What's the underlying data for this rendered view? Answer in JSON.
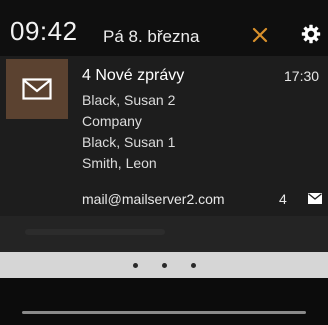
{
  "status": {
    "clock": "09:42",
    "date": "Pá 8. března",
    "dismiss_icon": "close-icon",
    "settings_icon": "gear-icon",
    "accent_color": "#d8902c"
  },
  "notification": {
    "app_icon": "mail-icon",
    "title": "4 Nové zprávy",
    "time": "17:30",
    "lines": [
      "Black, Susan 2",
      "Company",
      "Black, Susan 1",
      "Smith, Leon"
    ],
    "account": "mail@mailserver2.com",
    "count": "4",
    "account_icon": "mail-icon"
  },
  "pager": {
    "dots": 3
  }
}
